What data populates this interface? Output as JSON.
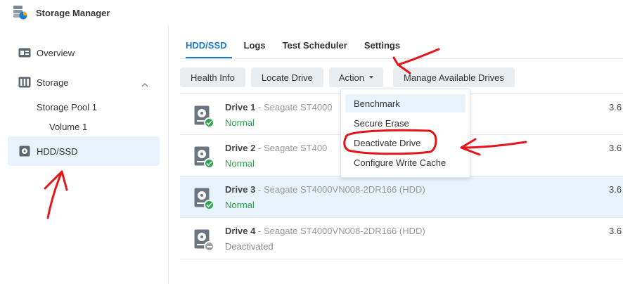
{
  "app": {
    "title": "Storage Manager"
  },
  "sidebar": {
    "overview": "Overview",
    "storage": "Storage",
    "storage_pool": "Storage Pool 1",
    "volume": "Volume 1",
    "hdd_ssd": "HDD/SSD"
  },
  "tabs": [
    "HDD/SSD",
    "Logs",
    "Test Scheduler",
    "Settings"
  ],
  "toolbar": {
    "health_info": "Health Info",
    "locate_drive": "Locate Drive",
    "action": "Action",
    "manage_drives": "Manage Available Drives"
  },
  "action_menu": [
    "Benchmark",
    "Secure Erase",
    "Deactivate Drive",
    "Configure Write Cache"
  ],
  "drives": [
    {
      "name": "Drive 1",
      "model": "- Seagate ST4000",
      "status": "Normal",
      "size": "3.6"
    },
    {
      "name": "Drive 2",
      "model": "- Seagate ST400",
      "status": "Normal",
      "size": "3.6"
    },
    {
      "name": "Drive 3",
      "model": "- Seagate ST4000VN008-2DR166 (HDD)",
      "status": "Normal",
      "size": "3.6"
    },
    {
      "name": "Drive 4",
      "model": "- Seagate ST4000VN008-2DR166 (HDD)",
      "status": "Deactivated",
      "size": "3.6"
    }
  ],
  "colors": {
    "accent": "#1c7cc8",
    "normal": "#2ea44f",
    "deactivated": "#9aa0a6",
    "annotation": "#e3161b"
  }
}
